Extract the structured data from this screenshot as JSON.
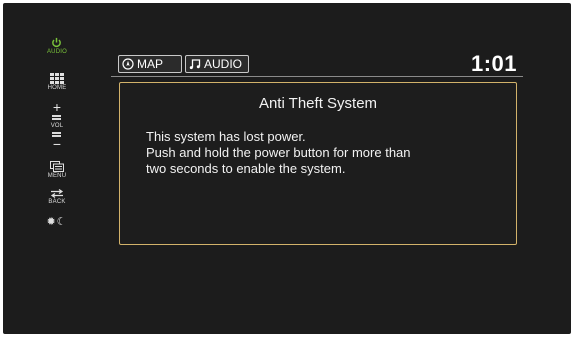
{
  "sidebar": {
    "power_label": "AUDIO",
    "home_label": "HOME",
    "vol_plus": "+",
    "vol_label": "VOL",
    "vol_minus": "−",
    "menu_label": "MENU",
    "back_label": "BACK"
  },
  "header": {
    "tabs": [
      {
        "label": "MAP",
        "icon": "compass-icon"
      },
      {
        "label": "AUDIO",
        "icon": "music-note-icon"
      }
    ],
    "clock": "1:01"
  },
  "dialog": {
    "title": "Anti Theft System",
    "lines": [
      "This system has lost power.",
      "Push and hold the power button for more than",
      "two seconds to enable the system."
    ]
  },
  "colors": {
    "background": "#1c1c1c",
    "power_green": "#79c23a",
    "dialog_border": "#d2b26a",
    "text": "#f2f2f2"
  }
}
